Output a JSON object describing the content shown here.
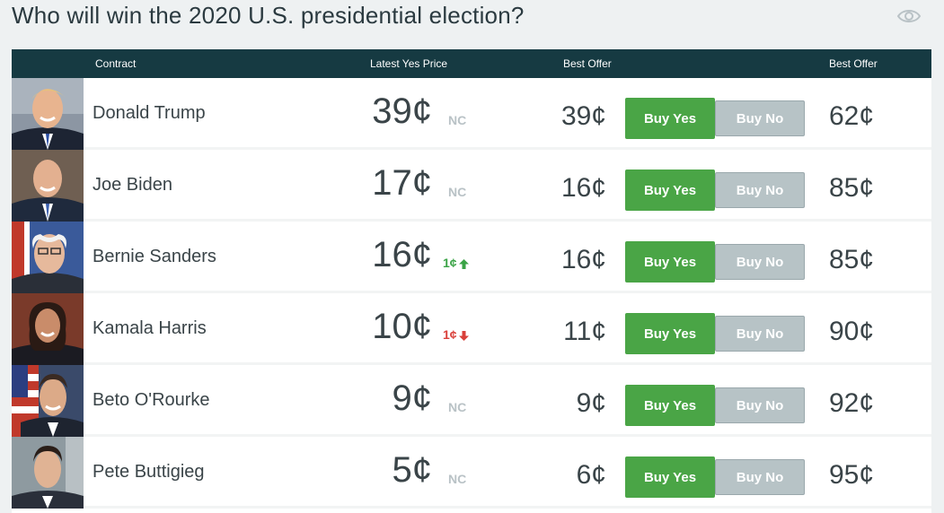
{
  "title": "Who will win the 2020 U.S. presidential election?",
  "header": {
    "contract": "Contract",
    "latest_yes_price": "Latest Yes Price",
    "best_offer_1": "Best Offer",
    "best_offer_2": "Best Offer"
  },
  "buttons": {
    "buy_yes": "Buy Yes",
    "buy_no": "Buy No"
  },
  "rows": [
    {
      "name": "Donald Trump",
      "price": "39¢",
      "change": "NC",
      "change_dir": "none",
      "best_offer_yes": "39¢",
      "best_offer_no": "62¢"
    },
    {
      "name": "Joe Biden",
      "price": "17¢",
      "change": "NC",
      "change_dir": "none",
      "best_offer_yes": "16¢",
      "best_offer_no": "85¢"
    },
    {
      "name": "Bernie Sanders",
      "price": "16¢",
      "change": "1¢",
      "change_dir": "up",
      "best_offer_yes": "16¢",
      "best_offer_no": "85¢"
    },
    {
      "name": "Kamala Harris",
      "price": "10¢",
      "change": "1¢",
      "change_dir": "down",
      "best_offer_yes": "11¢",
      "best_offer_no": "90¢"
    },
    {
      "name": "Beto O'Rourke",
      "price": "9¢",
      "change": "NC",
      "change_dir": "none",
      "best_offer_yes": "9¢",
      "best_offer_no": "92¢"
    },
    {
      "name": "Pete Buttigieg",
      "price": "5¢",
      "change": "NC",
      "change_dir": "none",
      "best_offer_yes": "6¢",
      "best_offer_no": "95¢"
    }
  ],
  "colors": {
    "header_bg": "#163a42",
    "buy_yes": "#4aa546",
    "buy_no": "#b7c3c6",
    "up": "#3aa346",
    "down": "#d9403a"
  },
  "icons": {
    "watch": "eye-icon",
    "up": "arrow-up-icon",
    "down": "arrow-down-icon"
  }
}
